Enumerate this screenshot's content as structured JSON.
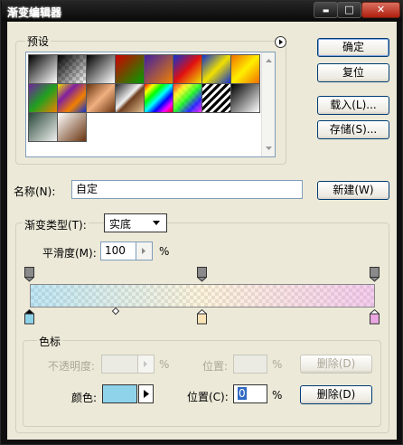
{
  "window": {
    "title": "渐变编辑器",
    "controls": {
      "minimize": "▬",
      "maximize": "□",
      "close": "✕"
    }
  },
  "buttons": {
    "ok": "确定",
    "reset": "复位",
    "load": "载入(L)...",
    "save": "存储(S)...",
    "new": "新建(W)",
    "delete_opacity": "删除(D)",
    "delete_color": "删除(D)"
  },
  "presets": {
    "label": "预设",
    "menu_icon": "right-arrow-circle-icon",
    "swatch_names": [
      "foreground-to-background",
      "foreground-to-transparent",
      "black-to-white",
      "red-green",
      "violet-orange",
      "blue-red-yellow",
      "blue-yellow-blue",
      "orange-yellow-orange",
      "violet-green-orange",
      "yellow-violet-orange-blue",
      "copper",
      "chrome",
      "spectrum",
      "transparent-rainbow",
      "transparent-stripes",
      "neutral-density",
      "green-gray",
      "white-brown"
    ]
  },
  "name": {
    "label": "名称(N):",
    "value": "自定"
  },
  "gradient_type": {
    "label": "渐变类型(T):",
    "value": "实底"
  },
  "smoothness": {
    "label": "平滑度(M):",
    "value": "100",
    "unit": "%"
  },
  "stops": {
    "group_label": "色标",
    "opacity_label": "不透明度:",
    "opacity_value": "",
    "opacity_unit": "%",
    "opacity_location_label": "位置:",
    "opacity_location_value": "",
    "opacity_location_unit": "%",
    "color_label": "颜色:",
    "color_value": "#8fd3ea",
    "color_location_label": "位置(C):",
    "color_location_value": "0",
    "color_location_unit": "%"
  },
  "gradient_colors": {
    "left": "#8fd3ea",
    "middle": "#f9e3b6",
    "right": "#e9a6e0"
  }
}
